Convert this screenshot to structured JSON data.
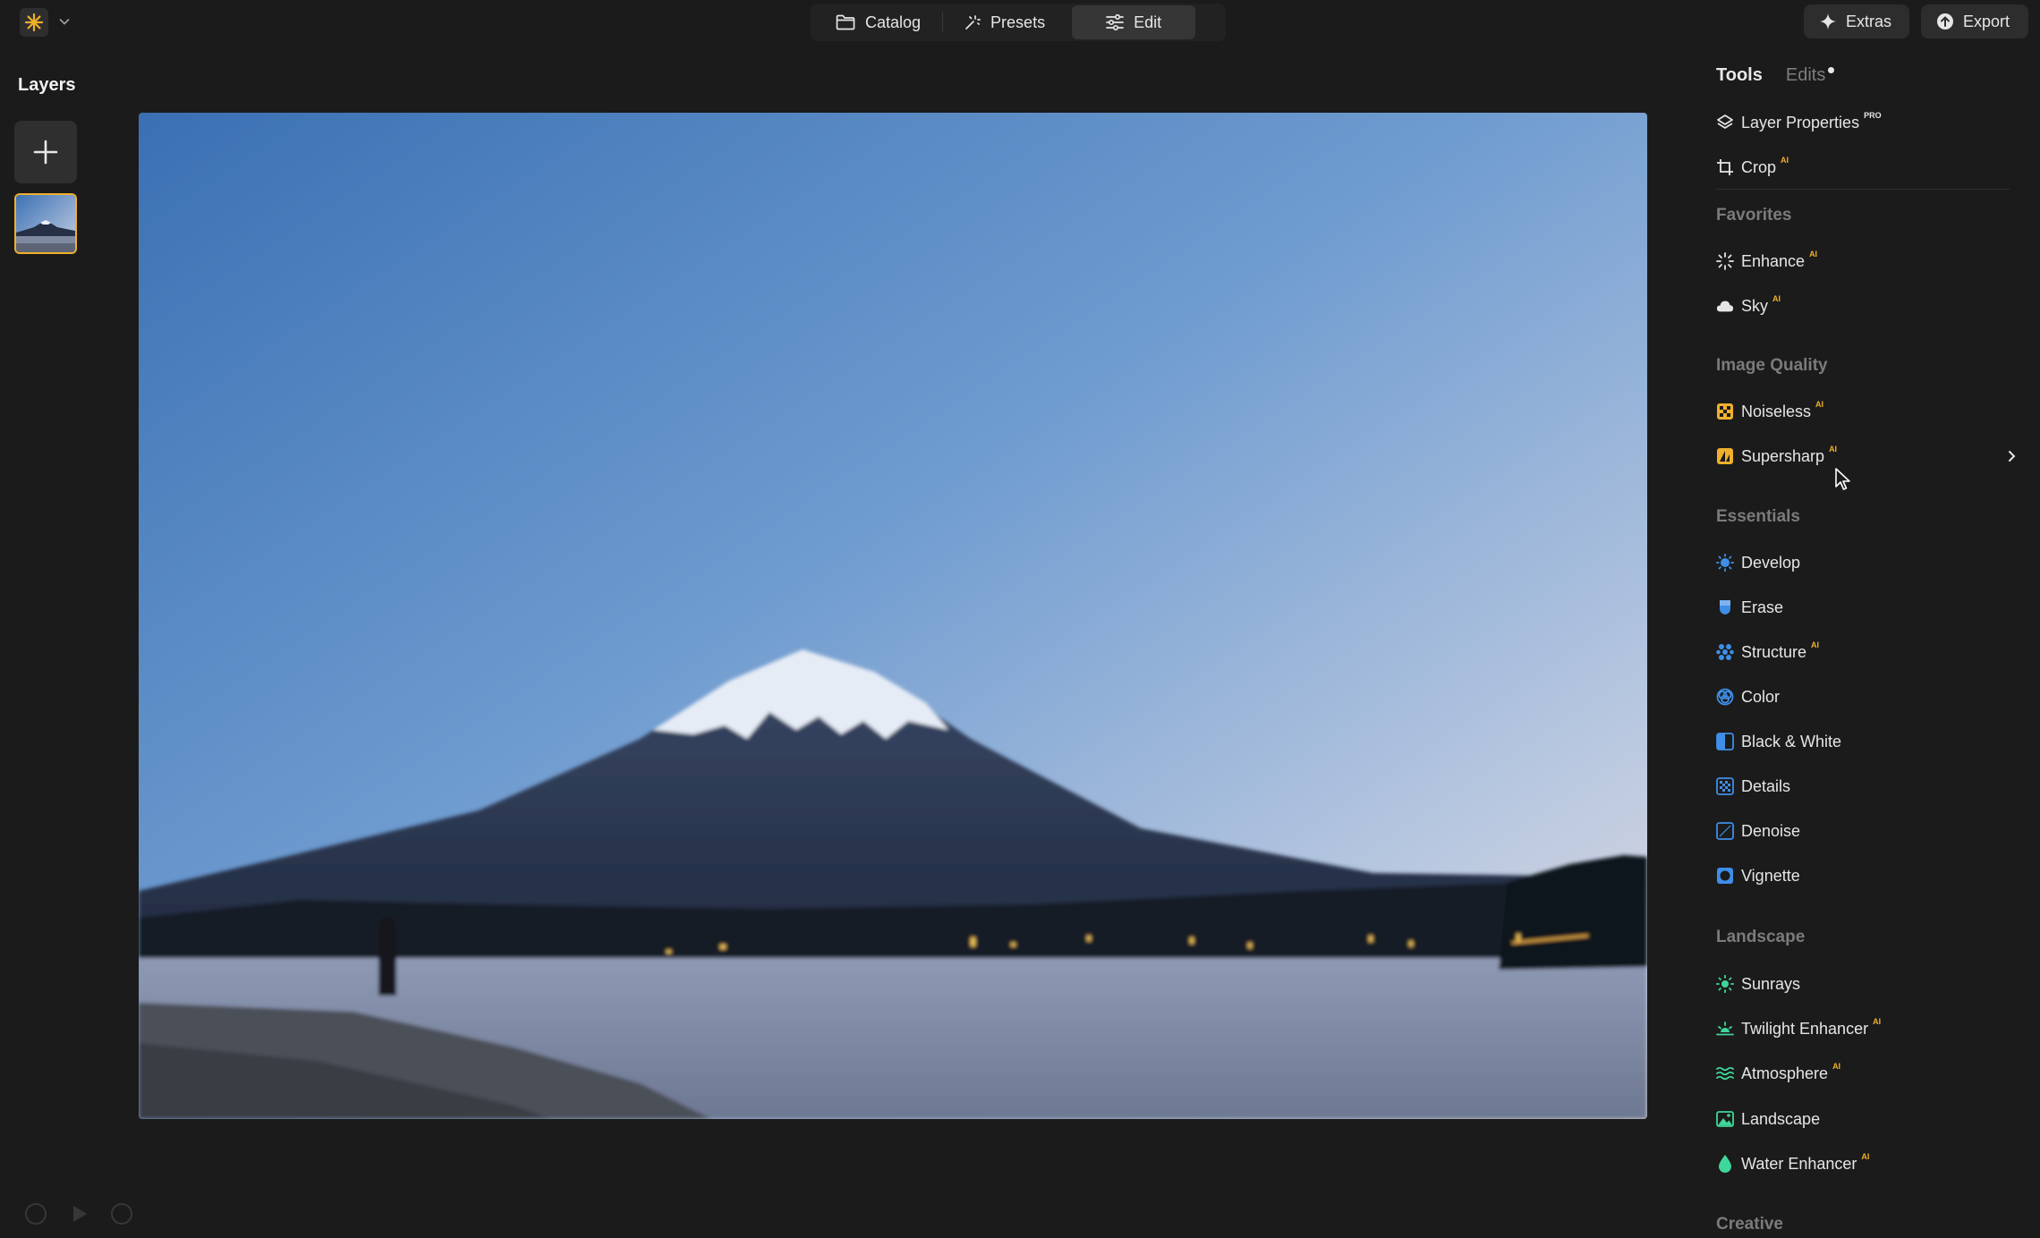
{
  "topbar": {
    "modes": [
      {
        "label": "Catalog",
        "icon": "folder-icon"
      },
      {
        "label": "Presets",
        "icon": "sparkle-icon"
      },
      {
        "label": "Edit",
        "icon": "sliders-icon",
        "active": true
      }
    ],
    "extras_label": "Extras",
    "export_label": "Export"
  },
  "layers": {
    "title": "Layers"
  },
  "panel": {
    "tabs": [
      {
        "label": "Tools",
        "active": true
      },
      {
        "label": "Edits",
        "active": false,
        "has_dot": true
      }
    ],
    "top_items": [
      {
        "label": "Layer Properties",
        "badge": "PRO",
        "icon": "layers-icon"
      },
      {
        "label": "Crop",
        "badge": "AI",
        "icon": "crop-icon"
      }
    ],
    "sections": [
      {
        "title": "Favorites",
        "items": [
          {
            "label": "Enhance",
            "badge": "AI",
            "icon": "enhance-icon"
          },
          {
            "label": "Sky",
            "badge": "AI",
            "icon": "cloud-icon"
          }
        ]
      },
      {
        "title": "Image Quality",
        "items": [
          {
            "label": "Noiseless",
            "badge": "AI",
            "icon": "noiseless-icon"
          },
          {
            "label": "Supersharp",
            "badge": "AI",
            "icon": "supersharp-icon",
            "has_arrow": true
          }
        ]
      },
      {
        "title": "Essentials",
        "items": [
          {
            "label": "Develop",
            "icon": "sun-icon"
          },
          {
            "label": "Erase",
            "icon": "eraser-icon"
          },
          {
            "label": "Structure",
            "badge": "AI",
            "icon": "structure-icon"
          },
          {
            "label": "Color",
            "icon": "color-icon"
          },
          {
            "label": "Black & White",
            "icon": "bw-icon"
          },
          {
            "label": "Details",
            "icon": "details-icon"
          },
          {
            "label": "Denoise",
            "icon": "denoise-icon"
          },
          {
            "label": "Vignette",
            "icon": "vignette-icon"
          }
        ]
      },
      {
        "title": "Landscape",
        "items": [
          {
            "label": "Sunrays",
            "icon": "sunrays-icon"
          },
          {
            "label": "Twilight Enhancer",
            "badge": "AI",
            "icon": "twilight-icon"
          },
          {
            "label": "Atmosphere",
            "badge": "AI",
            "icon": "atmosphere-icon"
          },
          {
            "label": "Landscape",
            "icon": "landscape-icon"
          },
          {
            "label": "Water Enhancer",
            "badge": "AI",
            "icon": "water-drop-icon"
          }
        ]
      },
      {
        "title": "Creative",
        "items": []
      }
    ]
  },
  "colors": {
    "accent": "#f0b02c",
    "essentials_blue": "#3f8ee8",
    "landscape_green": "#3ed69a",
    "background": "#1b1b1b"
  }
}
